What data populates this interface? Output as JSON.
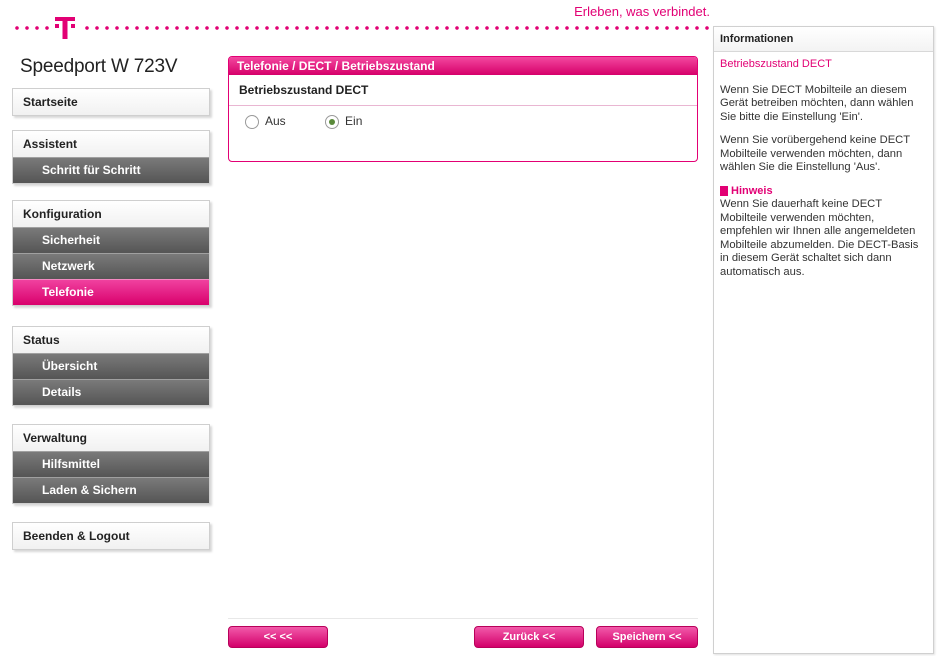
{
  "header": {
    "slogan": "Erleben, was verbindet.",
    "product": "Speedport W 723V",
    "logo_icon": "telekom-t-logo",
    "accent_color": "#e20074"
  },
  "sidebar": {
    "startseite": "Startseite",
    "assistent": {
      "title": "Assistent",
      "items": [
        "Schritt für Schritt"
      ]
    },
    "konfiguration": {
      "title": "Konfiguration",
      "items": [
        "Sicherheit",
        "Netzwerk",
        "Telefonie"
      ],
      "active": "Telefonie"
    },
    "status": {
      "title": "Status",
      "items": [
        "Übersicht",
        "Details"
      ]
    },
    "verwaltung": {
      "title": "Verwaltung",
      "items": [
        "Hilfsmittel",
        "Laden & Sichern"
      ]
    },
    "logout": "Beenden & Logout"
  },
  "main": {
    "breadcrumb": "Telefonie / DECT / Betriebszustand",
    "section_label": "Betriebszustand DECT",
    "options": [
      {
        "label": "Aus",
        "checked": false
      },
      {
        "label": "Ein",
        "checked": true
      }
    ]
  },
  "info": {
    "title": "Informationen",
    "subtitle": "Betriebszustand DECT",
    "paragraph1": "Wenn Sie DECT Mobilteile an diesem Gerät betreiben möchten, dann wählen Sie bitte die Einstellung 'Ein'.",
    "paragraph2": "Wenn Sie vorübergehend keine DECT Mobilteile verwenden möchten, dann wählen Sie die Einstellung 'Aus'.",
    "hint_title": "Hinweis",
    "hint_text": "Wenn Sie dauerhaft keine DECT Mobilteile verwenden möchten, empfehlen wir Ihnen alle angemeldeten Mobilteile abzumelden. Die DECT-Basis in diesem Gerät schaltet sich dann automatisch aus."
  },
  "buttons": {
    "first": "<< <<",
    "back": "Zurück <<",
    "save": "Speichern <<"
  }
}
